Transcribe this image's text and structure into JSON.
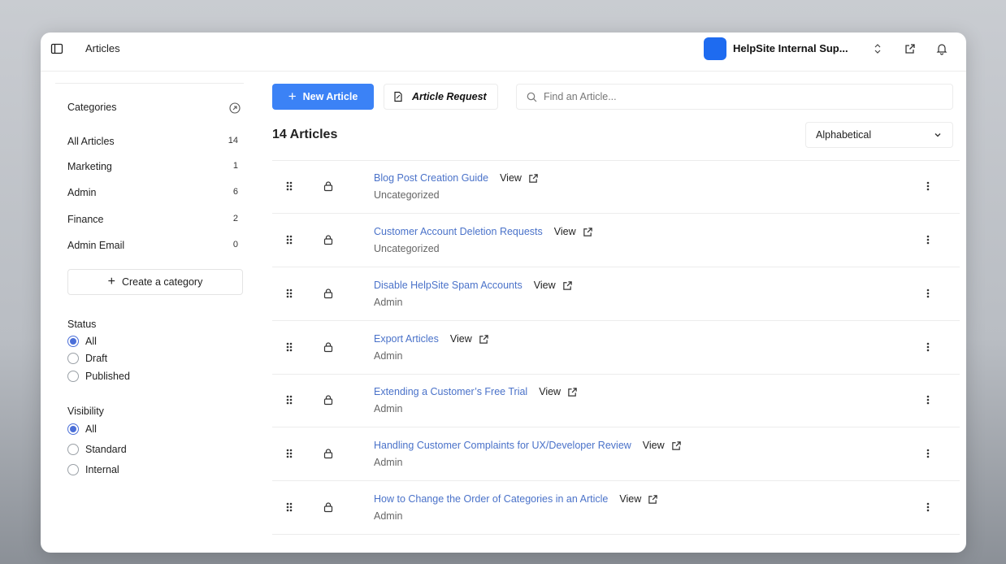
{
  "topbar": {
    "title": "Articles",
    "site_name": "HelpSite Internal Sup...",
    "icons": [
      "sidebar-toggle-icon",
      "chevron-up-down-icon",
      "external-link-icon",
      "bell-icon"
    ]
  },
  "sidebar": {
    "categories_title": "Categories",
    "categories": [
      {
        "name": "All Articles",
        "count": "14"
      },
      {
        "name": "Marketing",
        "count": "1"
      },
      {
        "name": "Admin",
        "count": "6"
      },
      {
        "name": "Finance",
        "count": "2"
      },
      {
        "name": "Admin Email",
        "count": "0"
      }
    ],
    "create_category_label": "Create a category",
    "status": {
      "title": "Status",
      "options": [
        "All",
        "Draft",
        "Published"
      ],
      "selected": "All"
    },
    "visibility": {
      "title": "Visibility",
      "options": [
        "All",
        "Standard",
        "Internal"
      ],
      "selected": "All"
    }
  },
  "toolbar": {
    "new_article_label": "New Article",
    "article_request_label": "Article Request",
    "search_placeholder": "Find an Article..."
  },
  "list": {
    "count_title": "14 Articles",
    "sort_selected": "Alphabetical",
    "view_label": "View",
    "articles": [
      {
        "title": "Blog Post Creation Guide",
        "category": "Uncategorized"
      },
      {
        "title": "Customer Account Deletion Requests",
        "category": "Uncategorized"
      },
      {
        "title": "Disable HelpSite Spam Accounts",
        "category": "Admin"
      },
      {
        "title": "Export Articles",
        "category": "Admin"
      },
      {
        "title": "Extending a Customer’s Free Trial",
        "category": "Admin"
      },
      {
        "title": "Handling Customer Complaints for UX/Developer Review",
        "category": "Admin"
      },
      {
        "title": "How to Change the Order of Categories in an Article",
        "category": "Admin"
      }
    ]
  },
  "colors": {
    "accent": "#3b82f6",
    "link": "#4a72c9",
    "site_logo": "#1e6bf0"
  }
}
